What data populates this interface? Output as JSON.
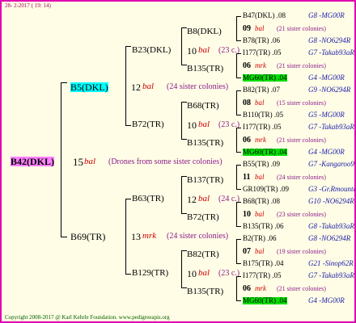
{
  "header": {
    "timestamp": "28- 2-2017 ( 19: 14)"
  },
  "footer": {
    "copyright": "Copyright 2008-2017 @ Karl Kehrle Foundation.   www.pedigreeapis.org"
  },
  "root": {
    "id": "B42(DKL)",
    "num": "15",
    "mark": "bal",
    "desc": "(Drones from some sister colonies)"
  },
  "gen1": {
    "top": {
      "id": "B5(DKL)",
      "num": "12",
      "mark": "bal",
      "desc": "(24 sister colonies)"
    },
    "bottom": {
      "id": "B69(TR)",
      "num": "13",
      "mark": "mrk",
      "desc": "(24 sister colonies)"
    }
  },
  "gen2": [
    {
      "id": "B23(DKL)",
      "num": "10",
      "mark": "bal",
      "desc": "(23 c.)"
    },
    {
      "id": "B72(TR)",
      "num": "10",
      "mark": "bal",
      "desc": "(23 c.)"
    },
    {
      "id": "B63(TR)",
      "num": "12",
      "mark": "bal",
      "desc": "(24 c.)"
    },
    {
      "id": "B129(TR)",
      "num": "10",
      "mark": "bal",
      "desc": "(23 c.)"
    }
  ],
  "gen3": [
    {
      "id": "B8(DKL)"
    },
    {
      "id": "B135(TR)"
    },
    {
      "id": "B68(TR)"
    },
    {
      "id": "B135(TR)"
    },
    {
      "id": "B137(TR)"
    },
    {
      "id": "B72(TR)"
    },
    {
      "id": "B82(TR)"
    },
    {
      "id": "B135(TR)"
    }
  ],
  "gen4": [
    {
      "top": "B47(DKL) .08",
      "top_loc": "G8 -MG00R",
      "num": "09",
      "mark": "bal",
      "desc": "(21 sister colonies)",
      "bot": "B78(TR) .06",
      "bot_loc": "G8 -NO6294R"
    },
    {
      "top": "I177(TR) .05",
      "top_loc": "G7 -Takab93aR",
      "num": "06",
      "mark": "mrk",
      "desc": "(21 sister colonies)",
      "bot": "MG60(TR) .04",
      "bot_loc": "G4 -MG00R"
    },
    {
      "top": "B82(TR) .07",
      "top_loc": "G9 -NO6294R",
      "num": "08",
      "mark": "bal",
      "desc": "(15 sister colonies)",
      "bot": "B110(TR) .05",
      "bot_loc": "G5 -MG00R"
    },
    {
      "top": "I177(TR) .05",
      "top_loc": "G7 -Takab93aR",
      "num": "06",
      "mark": "mrk",
      "desc": "(21 sister colonies)",
      "bot": "MG60(TR) .04",
      "bot_loc": "G4 -MG00R"
    },
    {
      "top": "B55(TR) .09",
      "top_loc": "G7 -Kangaroo98R",
      "num": "11",
      "mark": "bal",
      "desc": "(24 sister colonies)",
      "bot": "GR109(TR) .09",
      "bot_loc": "G3 -Gr.Rmounta"
    },
    {
      "top": "B68(TR) .08",
      "top_loc": "G10 -NO6294R",
      "num": "10",
      "mark": "bal",
      "desc": "(23 sister colonies)",
      "bot": "B135(TR) .06",
      "bot_loc": "G8 -Takab93aR"
    },
    {
      "top": "B2(TR) .06",
      "top_loc": "G8 -NO6294R",
      "num": "07",
      "mark": "bal",
      "desc": "(19 sister colonies)",
      "bot": "B175(TR) .04",
      "bot_loc": "G21 -Sinop62R"
    },
    {
      "top": "I177(TR) .05",
      "top_loc": "G7 -Takab93aR",
      "num": "06",
      "mark": "mrk",
      "desc": "(21 sister colonies)",
      "bot": "MG60(TR) .04",
      "bot_loc": "G4 -MG00R"
    }
  ]
}
